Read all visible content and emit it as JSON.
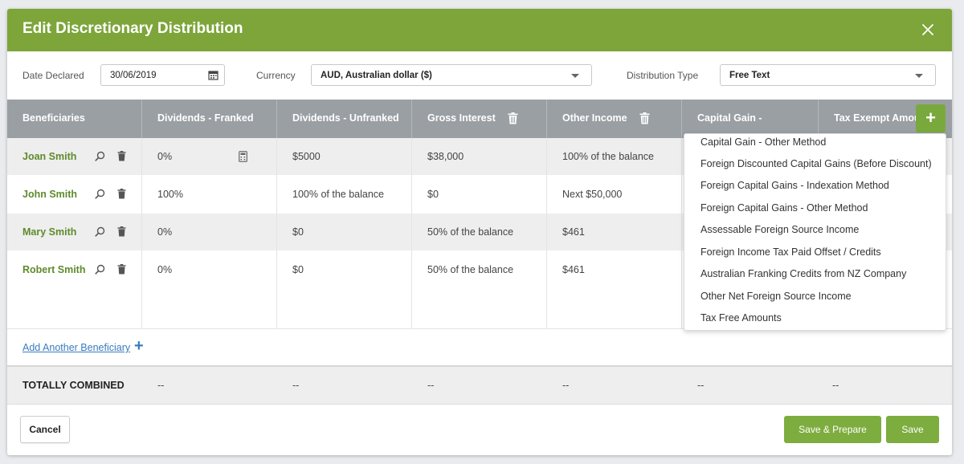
{
  "dialog": {
    "title": "Edit Discretionary Distribution"
  },
  "filters": {
    "date_label": "Date Declared",
    "date_value": "30/06/2019",
    "currency_label": "Currency",
    "currency_value": "AUD, Australian dollar ($)",
    "type_label": "Distribution Type",
    "type_value": "Free Text"
  },
  "table": {
    "columns": [
      "Beneficiaries",
      "Dividends - Franked",
      "Dividends - Unfranked",
      "Gross Interest",
      "Other Income",
      "Capital Gain -",
      "Tax Exempt Amounts"
    ],
    "rows": [
      {
        "name": "Joan Smith",
        "franked": "0%",
        "unfranked": "$5000",
        "interest": "$38,000",
        "other": "100% of the balance"
      },
      {
        "name": "John Smith",
        "franked": "100%",
        "unfranked": "100% of the balance",
        "interest": "$0",
        "other": "Next $50,000"
      },
      {
        "name": "Mary Smith",
        "franked": "0%",
        "unfranked": "$0",
        "interest": "50% of the balance",
        "other": "$461"
      },
      {
        "name": "Robert Smith",
        "franked": "0%",
        "unfranked": "$0",
        "interest": "50% of the balance",
        "other": "$461"
      }
    ],
    "add_beneficiary": "Add Another Beneficiary",
    "totals_label": "TOTALLY COMBINED",
    "totals": [
      "--",
      "--",
      "--",
      "--",
      "--",
      "--"
    ]
  },
  "dropdown": {
    "items": [
      "Capital Gain - Other Method",
      "Foreign Discounted Capital Gains (Before Discount)",
      "Foreign Capital Gains - Indexation Method",
      "Foreign Capital Gains - Other Method",
      "Assessable Foreign Source Income",
      "Foreign Income Tax Paid Offset / Credits",
      "Australian Franking Credits from NZ Company",
      "Other Net Foreign Source Income",
      "Tax Free Amounts"
    ]
  },
  "footer": {
    "cancel": "Cancel",
    "save_prepare": "Save & Prepare",
    "save": "Save"
  },
  "colors": {
    "header": "#7da53a",
    "accent_green": "#7dad3f",
    "table_header": "#9a9fa3",
    "link_blue": "#3a7bbf"
  }
}
